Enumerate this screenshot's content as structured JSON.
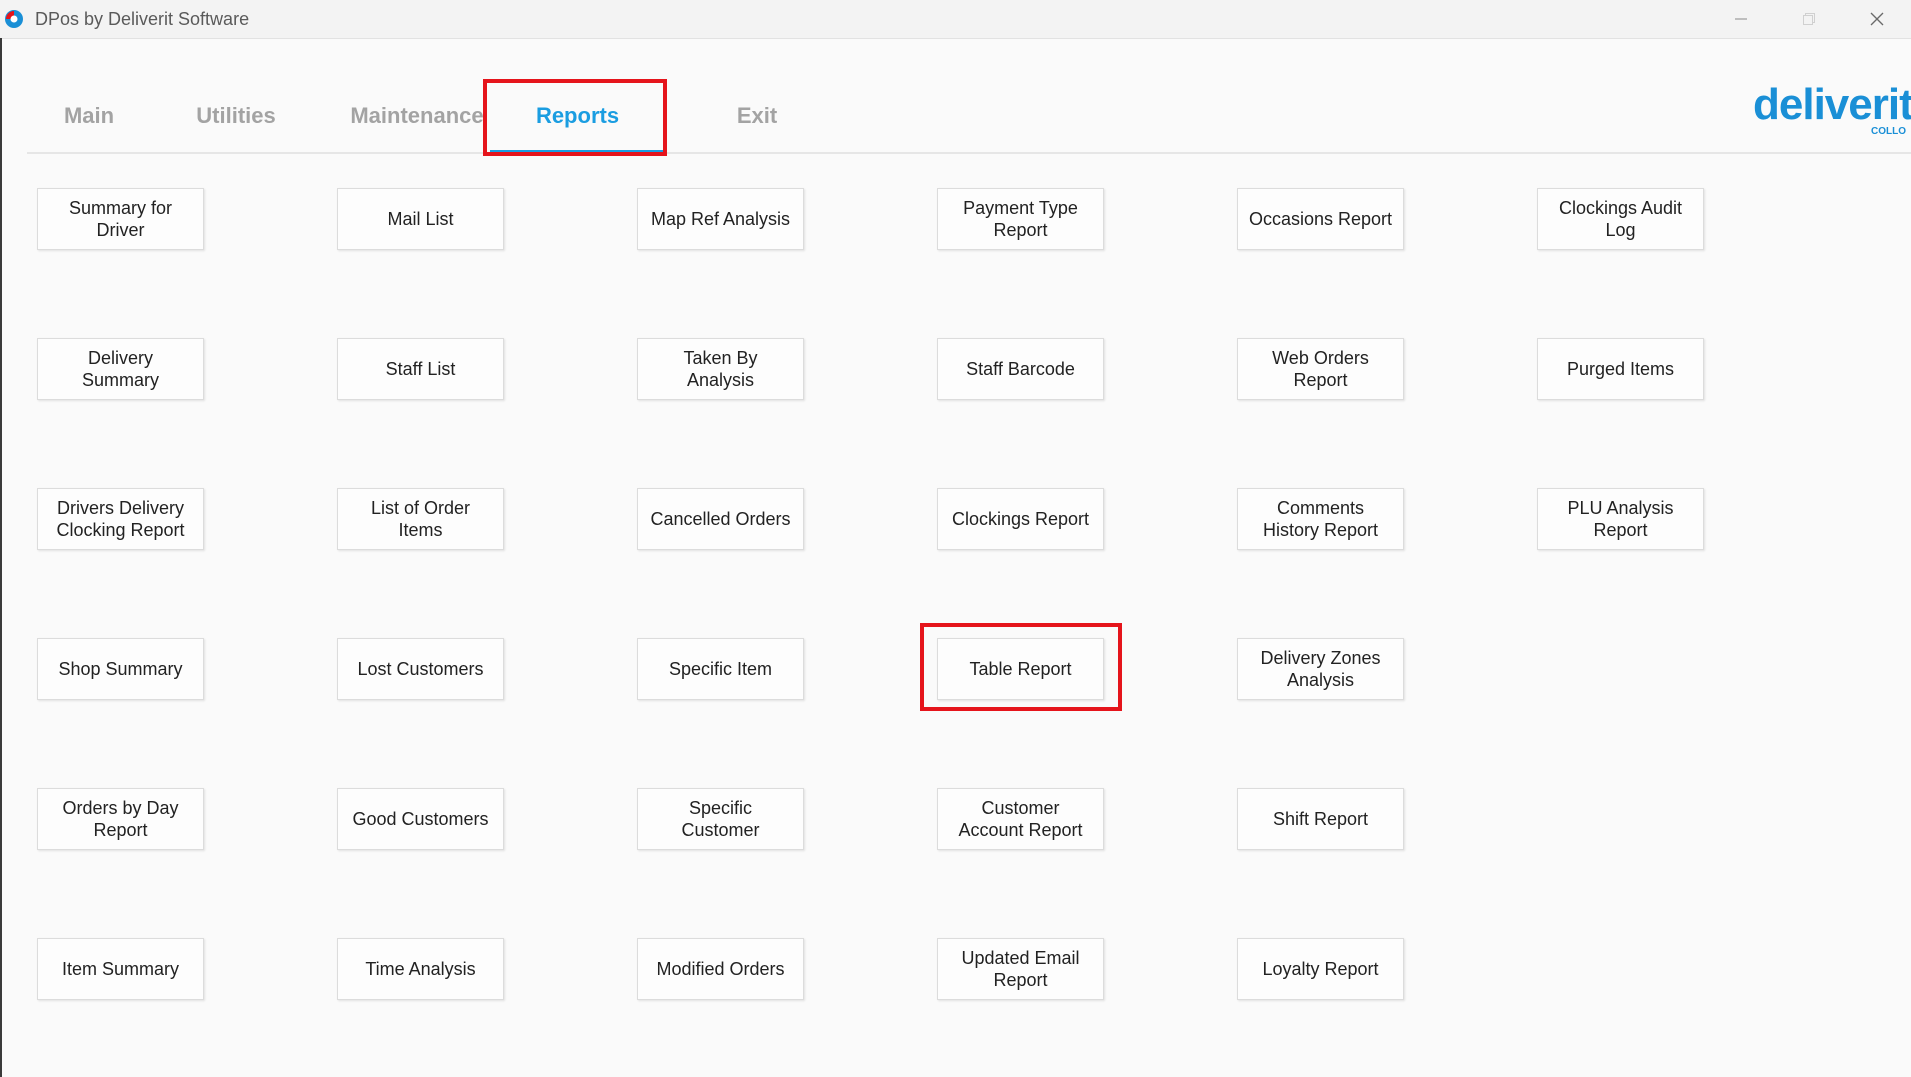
{
  "window": {
    "title": "DPos by Deliverit Software"
  },
  "tabs": [
    {
      "label": "Main"
    },
    {
      "label": "Utilities"
    },
    {
      "label": "Maintenance"
    },
    {
      "label": "Reports"
    },
    {
      "label": "Exit"
    }
  ],
  "active_tab": "Reports",
  "logo": {
    "text": "deliverit",
    "sub": "COLLO"
  },
  "colors": {
    "accent": "#1a9de1",
    "highlight": "#e5141b",
    "tab_inactive": "#a3a3a3"
  },
  "reports": {
    "col1": [
      "Summary for Driver",
      "Delivery Summary",
      "Drivers Delivery Clocking Report",
      "Shop Summary",
      "Orders by Day Report",
      "Item Summary"
    ],
    "col2": [
      "Mail List",
      "Staff List",
      "List of Order Items",
      "Lost Customers",
      "Good Customers",
      "Time Analysis"
    ],
    "col3": [
      "Map Ref Analysis",
      "Taken By Analysis",
      "Cancelled Orders",
      "Specific Item",
      "Specific Customer",
      "Modified Orders"
    ],
    "col4": [
      "Payment Type Report",
      "Staff Barcode",
      "Clockings Report",
      "Table Report",
      "Customer Account Report",
      "Updated Email Report"
    ],
    "col5": [
      "Occasions Report",
      "Web Orders Report",
      "Comments History Report",
      "Delivery Zones Analysis",
      "Shift Report",
      "Loyalty Report"
    ],
    "col6": [
      "Clockings Audit Log",
      "Purged Items",
      "PLU Analysis Report"
    ]
  }
}
